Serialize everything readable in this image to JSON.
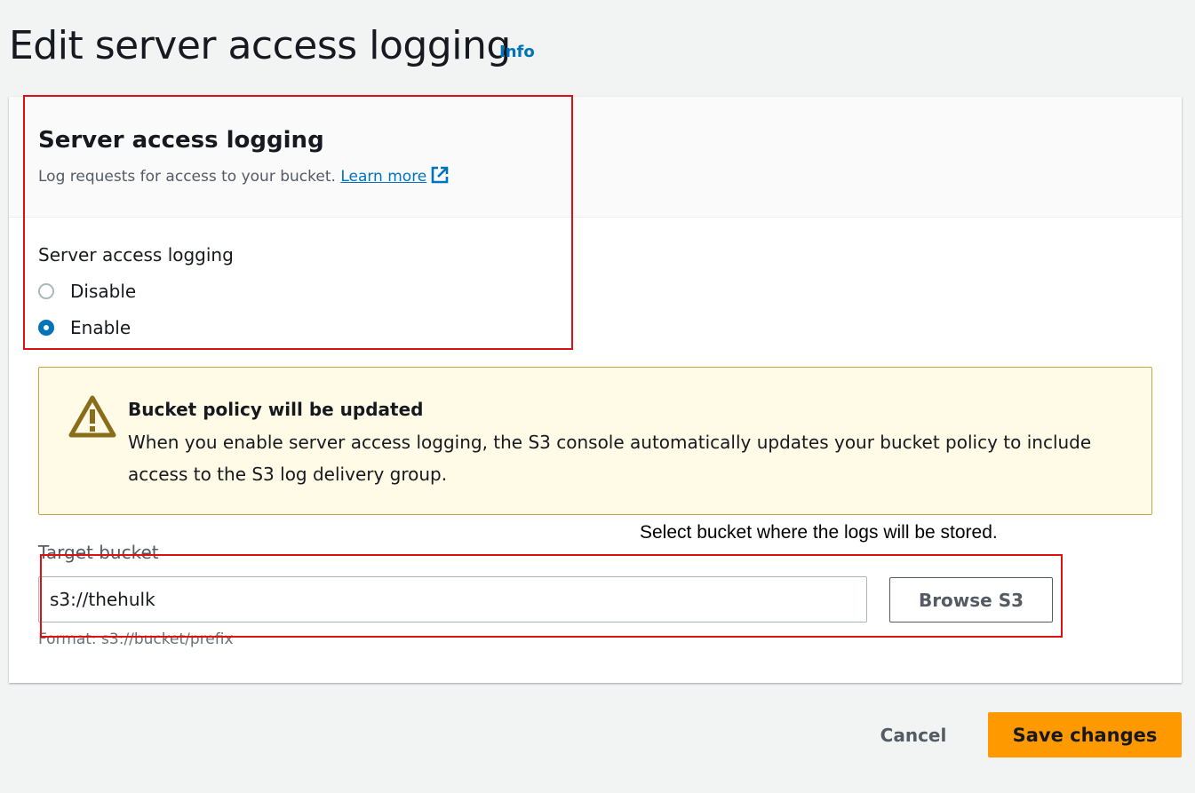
{
  "header": {
    "title": "Edit server access logging",
    "info_label": "Info"
  },
  "panel": {
    "title": "Server access logging",
    "description": "Log requests for access to your bucket.",
    "learn_more_label": "Learn more"
  },
  "logging_setting": {
    "label": "Server access logging",
    "options": [
      {
        "label": "Disable",
        "selected": false
      },
      {
        "label": "Enable",
        "selected": true
      }
    ]
  },
  "alert": {
    "icon": "warning-icon",
    "title": "Bucket policy will be updated",
    "body": "When you enable server access logging, the S3 console automatically updates your bucket policy to include access to the S3 log delivery group."
  },
  "target_bucket": {
    "label": "Target bucket",
    "value": "s3://thehulk",
    "browse_label": "Browse S3",
    "format_hint": "Format: s3://bucket/prefix"
  },
  "annotation": {
    "text": "Select bucket where the logs will be stored.",
    "color": "#e01010"
  },
  "actions": {
    "cancel_label": "Cancel",
    "save_label": "Save changes"
  },
  "colors": {
    "accent": "#0073bb",
    "primary_button": "#ff9900",
    "warning_border": "#c7a53c",
    "warning_bg": "#fffbe6"
  }
}
